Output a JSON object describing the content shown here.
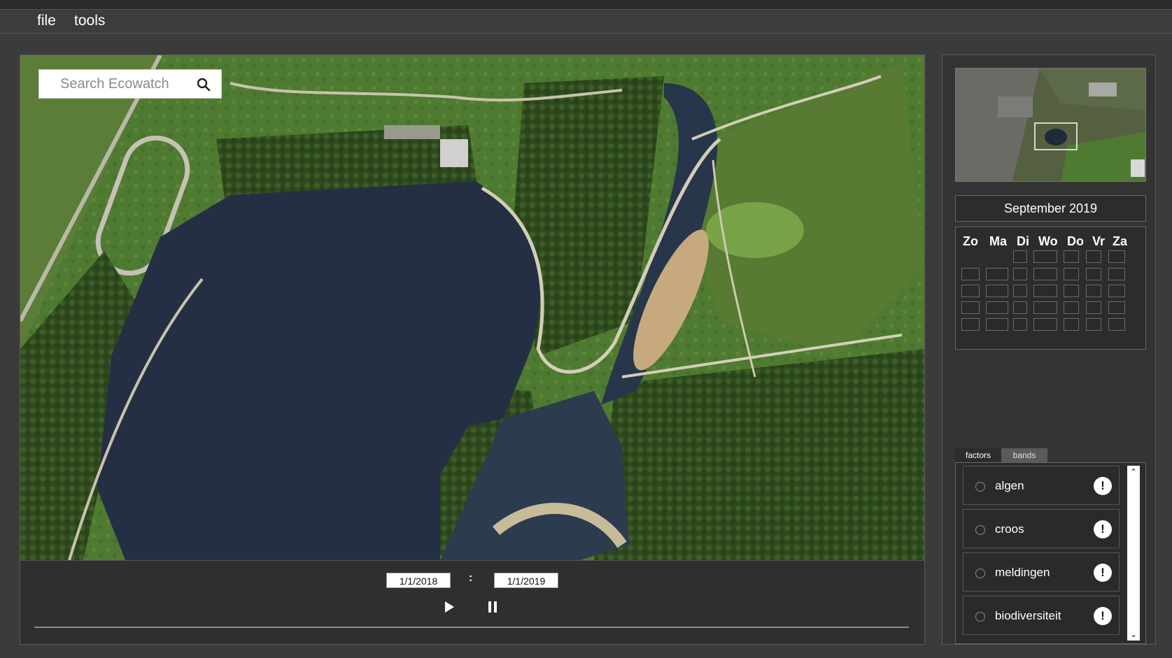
{
  "menubar": {
    "items": [
      {
        "label": "file"
      },
      {
        "label": "tools"
      }
    ]
  },
  "search": {
    "placeholder": "Search Ecowatch",
    "icon": "search-icon"
  },
  "map": {
    "type": "satellite-aerial",
    "water_color": "#25324a",
    "vegetation_color": "#3f5f2b"
  },
  "timeline": {
    "start_date": "1/1/2018",
    "separator": ":",
    "end_date": "1/1/2019",
    "play_icon": "play-icon",
    "pause_icon": "pause-icon"
  },
  "minimap": {
    "type": "overview-map"
  },
  "calendar": {
    "month_label": "September 2019",
    "weekdays": [
      "Zo",
      "Ma",
      "Di",
      "Wo",
      "Do",
      "Vr",
      "Za"
    ]
  },
  "tabs": [
    {
      "label": "factors",
      "active": true
    },
    {
      "label": "bands",
      "active": false
    }
  ],
  "factors": [
    {
      "label": "algen",
      "alert": "!"
    },
    {
      "label": "croos",
      "alert": "!"
    },
    {
      "label": "meldingen",
      "alert": "!"
    },
    {
      "label": "biodiversiteit",
      "alert": "!"
    }
  ],
  "scrollbar": {
    "up_glyph": "⌃",
    "down_glyph": "⌄"
  }
}
